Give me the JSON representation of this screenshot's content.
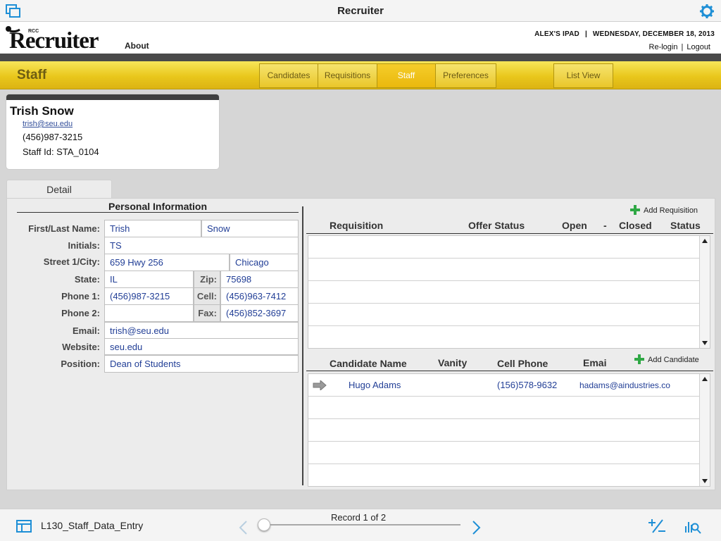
{
  "window": {
    "title": "Recruiter"
  },
  "header": {
    "logo_small": "RCC",
    "logo_word": "Recruiter",
    "about": "About",
    "device": "ALEX'S IPAD",
    "date": "WEDNESDAY, DECEMBER 18, 2013",
    "relogin": "Re-login",
    "logout": "Logout"
  },
  "nav": {
    "section_title": "Staff",
    "tabs": [
      "Candidates",
      "Requisitions",
      "Staff",
      "Preferences"
    ],
    "active_tab": "Staff",
    "list_view": "List View"
  },
  "card": {
    "name": "Trish Snow",
    "email": "trish@seu.edu",
    "phone": "(456)987-3215",
    "staff_id": "Staff Id: STA_0104"
  },
  "detail_tab": "Detail",
  "personal": {
    "title": "Personal Information",
    "labels": {
      "name": "First/Last Name:",
      "initials": "Initials:",
      "street": "Street 1/City:",
      "state": "State:",
      "zip": "Zip:",
      "phone1": "Phone 1:",
      "cell": "Cell:",
      "phone2": "Phone 2:",
      "fax": "Fax:",
      "email": "Email:",
      "website": "Website:",
      "position": "Position:"
    },
    "values": {
      "first": "Trish",
      "last": "Snow",
      "initials": "TS",
      "street": "659 Hwy 256",
      "city": "Chicago",
      "state": "IL",
      "zip": "75698",
      "phone1": "(456)987-3215",
      "cell": "(456)963-7412",
      "phone2": "",
      "fax": "(456)852-3697",
      "email": "trish@seu.edu",
      "website": "seu.edu",
      "position": "Dean of Students"
    }
  },
  "requisitions": {
    "add_label": "Add Requisition",
    "headers": {
      "requisition": "Requisition",
      "offer_status": "Offer Status",
      "open": "Open",
      "dash": "-",
      "closed": "Closed",
      "status": "Status"
    }
  },
  "candidates": {
    "add_label": "Add Candidate",
    "headers": {
      "name": "Candidate Name",
      "vanity": "Vanity",
      "cell": "Cell Phone",
      "email": "Emai"
    },
    "rows": [
      {
        "name": "Hugo Adams",
        "vanity": "",
        "cell": "(156)578-9632",
        "email": "hadams@aindustries.co"
      }
    ]
  },
  "footer": {
    "layout": "L130_Staff_Data_Entry",
    "record": "Record 1 of 2",
    "record_position": 0.0
  },
  "colors": {
    "accent": "#1e8fd6",
    "nav_yellow": "#e9c71c",
    "active_tab": "#eab80d",
    "link_blue": "#213e96"
  }
}
